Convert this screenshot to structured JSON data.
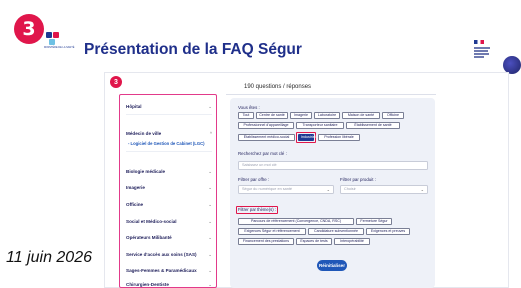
{
  "slide": {
    "step_number": "3",
    "title": "Présentation de la FAQ Ségur",
    "date": "11 juin 2026",
    "logo_text": "MINISTÈRE DE LA SANTÉ"
  },
  "faq": {
    "sub_step_number": "3",
    "questions_count": "190 questions / réponses",
    "sidebar": {
      "items": [
        {
          "label": "Hôpital",
          "chev": "⌄"
        },
        {
          "label": "Médecin de ville",
          "chev": "^"
        },
        {
          "label": "Biologie médicale",
          "chev": "⌄"
        },
        {
          "label": "Imagerie",
          "chev": "⌄"
        },
        {
          "label": "Officine",
          "chev": "⌄"
        },
        {
          "label": "Social et Médico-social",
          "chev": "⌄"
        },
        {
          "label": "Opérateurs Milibanté",
          "chev": "⌄"
        },
        {
          "label": "Service d'accès aux soins (SAS)",
          "chev": "⌄"
        },
        {
          "label": "Sages-Femmes & Paramédicaux",
          "chev": "⌄"
        },
        {
          "label": "Chirurgien-Dentiste",
          "chev": "⌄"
        }
      ],
      "sub_item": "- Logiciel de Gestion de Cabinet (LGC)"
    },
    "filters": {
      "vous_etes_label": "Vous êtes :",
      "vous_etes_chips": [
        "Tout",
        "Centre de santé",
        "Imagerie",
        "Laboratoire",
        "Maison de santé",
        "Officine",
        "Professionnel d'appareillage",
        "Transporteur sanitaire",
        "Établissement de santé",
        "Établissement médico-social",
        "Industriel",
        "Profession libérale"
      ],
      "active_chip": "Industriel",
      "search_label": "Recherchez par mot clé :",
      "search_placeholder": "Saisissez un mot clé",
      "offer_label": "Filtrer par offre :",
      "offer_placeholder": "Ségur du numérique en santé",
      "product_label": "Filtrer par produit :",
      "product_placeholder": "Choisir",
      "theme_label": "Filtrer par thème(s) :",
      "theme_chips": [
        "Parcours de référencement (Convergence, CNDA, RSC)",
        "Fermeture Ségur",
        "Exigences Ségur et référencement",
        "Candidature subventionnée",
        "Exigences et preuves",
        "Financement des prestations",
        "Espaces de tests",
        "Interopérabilité"
      ],
      "reset_label": "Réinitialiser"
    }
  }
}
